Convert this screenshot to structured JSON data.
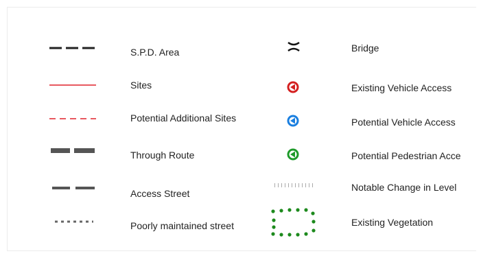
{
  "legend": {
    "left": [
      {
        "label": "S.P.D. Area",
        "icon": "black-dashed-line-icon",
        "color": "#222222"
      },
      {
        "label": "Sites",
        "icon": "red-solid-line-icon",
        "color": "#e0202a"
      },
      {
        "label": "Potential Additional Sites",
        "icon": "red-dashed-line-icon",
        "color": "#e0202a"
      },
      {
        "label": "Through Route",
        "icon": "thick-grey-dashed-line-icon",
        "color": "#555555"
      },
      {
        "label": "Access Street",
        "icon": "grey-dashed-line-icon",
        "color": "#555555"
      },
      {
        "label": "Poorly maintained street",
        "icon": "grey-dotted-line-icon",
        "color": "#666666"
      }
    ],
    "right": [
      {
        "label": "Bridge",
        "icon": "bridge-icon",
        "color": "#111111"
      },
      {
        "label": "Existing Vehicle Access",
        "icon": "red-access-arrow-icon",
        "color": "#d42020"
      },
      {
        "label": "Potential Vehicle Access",
        "icon": "blue-access-arrow-icon",
        "color": "#1a7fe0"
      },
      {
        "label": "Potential Pedestrian Acce",
        "icon": "green-access-arrow-icon",
        "color": "#1e9a2a"
      },
      {
        "label": "Notable Change in Level",
        "icon": "level-change-tick-icon",
        "color": "#aaaaaa"
      },
      {
        "label": "Existing Vegetation",
        "icon": "vegetation-dots-icon",
        "color": "#1d8a1d"
      }
    ]
  }
}
